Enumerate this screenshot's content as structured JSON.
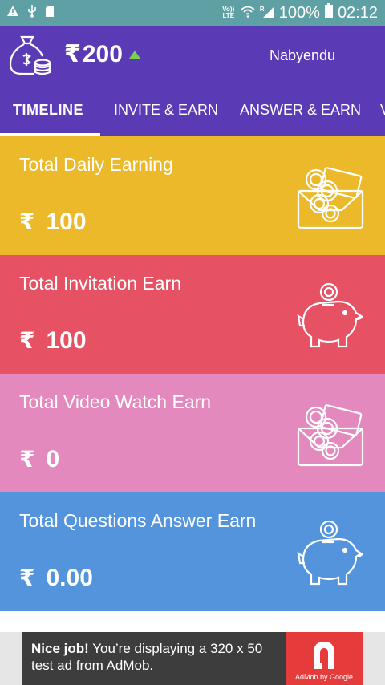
{
  "status_bar": {
    "network_label": "Vo)) LTE",
    "roaming_mark": "R",
    "battery": "100%",
    "time": "02:12"
  },
  "header": {
    "currency_symbol": "₹",
    "balance": "200",
    "username": "Nabyendu"
  },
  "tabs": [
    {
      "label": "TIMELINE",
      "active": true
    },
    {
      "label": "INVITE & EARN",
      "active": false
    },
    {
      "label": "ANSWER & EARN",
      "active": false
    },
    {
      "label": "V",
      "active": false
    }
  ],
  "cards": [
    {
      "title": "Total Daily Earning",
      "currency": "₹",
      "amount": "100",
      "color": "#ecb92a",
      "icon": "money-icon"
    },
    {
      "title": "Total Invitation Earn",
      "currency": "₹",
      "amount": "100",
      "color": "#e65264",
      "icon": "piggy-bank-icon"
    },
    {
      "title": "Total Video Watch Earn",
      "currency": "₹",
      "amount": "0",
      "color": "#e489bd",
      "icon": "money-icon"
    },
    {
      "title": "Total Questions Answer Earn",
      "currency": "₹",
      "amount": "0.00",
      "color": "#5494dd",
      "icon": "piggy-bank-icon"
    }
  ],
  "ad": {
    "bold": "Nice job!",
    "text": " You’re displaying a 320 x 50 test ad from AdMob.",
    "logo_caption": "AdMob by Google"
  },
  "colors": {
    "status_bar": "#5fa0a4",
    "header": "#5b3bb5",
    "indicator_up": "#79d249"
  }
}
